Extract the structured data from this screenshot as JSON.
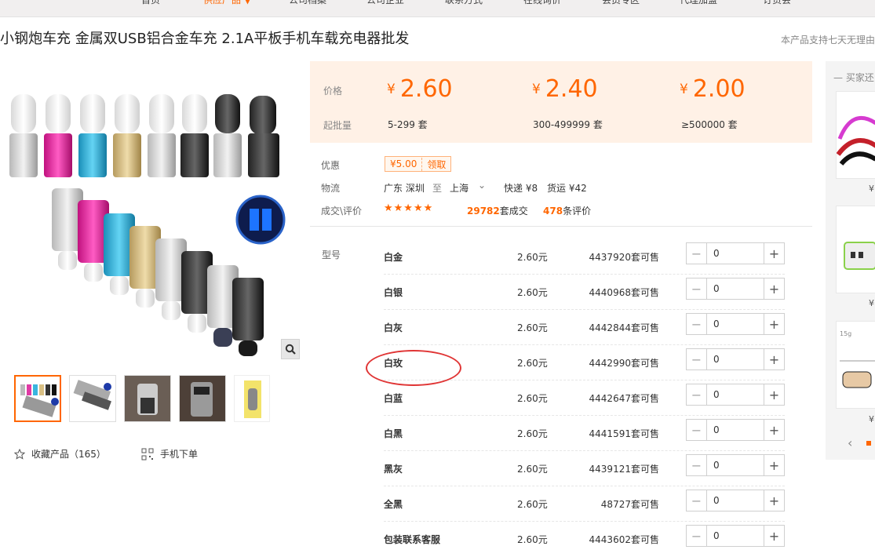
{
  "nav": [
    "首页",
    "供应产品 ▼",
    "公司档案",
    "公司企业",
    "联系方式",
    "在线询价",
    "会员专区",
    "代理加盟",
    "订货会"
  ],
  "title": "小钢炮车充 金属双USB铝合金车充 2.1A平板手机车载充电器批发",
  "title_note": "本产品支持七天无理由",
  "price_label": "价格",
  "moq_label": "起批量",
  "currency": "¥",
  "tiers": [
    {
      "price": "2.60",
      "range": "5-299 套"
    },
    {
      "price": "2.40",
      "range": "300-499999 套"
    },
    {
      "price": "2.00",
      "range": "≥500000 套"
    }
  ],
  "discount_label": "优惠",
  "coupon": {
    "amount": "¥5.00",
    "action": "领取"
  },
  "logistics_label": "物流",
  "logistics": {
    "from": "广东 深圳",
    "to_word": "至",
    "to": "上海",
    "express": "快递 ¥8",
    "freight": "货运 ¥42"
  },
  "deal_label": "成交\\评价",
  "stars": "★★★★★",
  "deals": {
    "count": "29782",
    "count_unit": "套成交",
    "reviews": "478",
    "reviews_unit": "条评价"
  },
  "sku_label": "型号",
  "skus": [
    {
      "name": "白金",
      "price": "2.60元",
      "stock": "4437920",
      "qty": "0"
    },
    {
      "name": "白银",
      "price": "2.60元",
      "stock": "4440968",
      "qty": "0"
    },
    {
      "name": "白灰",
      "price": "2.60元",
      "stock": "4442844",
      "qty": "0"
    },
    {
      "name": "白玫",
      "price": "2.60元",
      "stock": "4442990",
      "qty": "0"
    },
    {
      "name": "白蓝",
      "price": "2.60元",
      "stock": "4442647",
      "qty": "0"
    },
    {
      "name": "白黑",
      "price": "2.60元",
      "stock": "4441591",
      "qty": "0"
    },
    {
      "name": "黑灰",
      "price": "2.60元",
      "stock": "4439121",
      "qty": "0"
    },
    {
      "name": "全黑",
      "price": "2.60元",
      "stock": "48727",
      "qty": "0"
    },
    {
      "name": "包装联系客服",
      "price": "2.60元",
      "stock": "4443602",
      "qty": "0"
    }
  ],
  "stock_suffix": "套可售",
  "favorite": {
    "label": "收藏产品（165）"
  },
  "mobile_order": "手机下单",
  "sidebar": {
    "title": "买家还",
    "prices": [
      "¥",
      "¥",
      "¥"
    ]
  },
  "colors": {
    "accent": "#ff6600",
    "price_bg": "#fff1e6"
  }
}
